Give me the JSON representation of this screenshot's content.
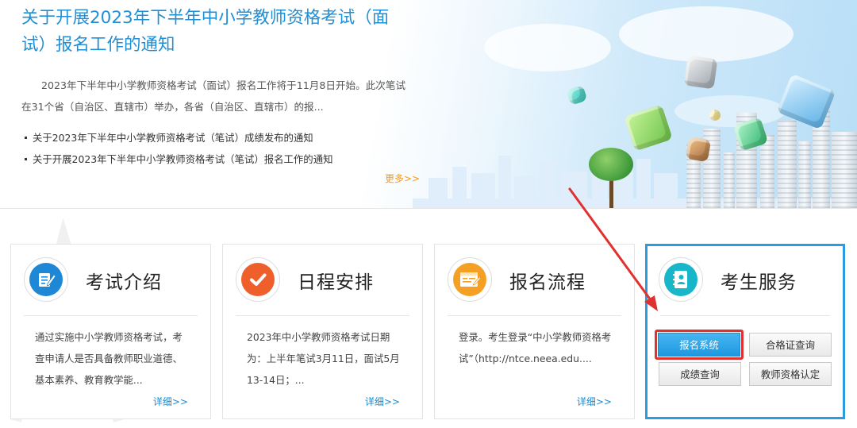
{
  "banner": {
    "headline": "关于开展2023年下半年中小学教师资格考试（面试）报名工作的通知",
    "summary": "2023年下半年中小学教师资格考试（面试）报名工作将于11月8日开始。此次笔试在31个省（自治区、直辖市）举办，各省（自治区、直辖市）的报...",
    "related": [
      "关于2023年下半年中小学教师资格考试（笔试）成绩发布的通知",
      "关于开展2023年下半年中小学教师资格考试（笔试）报名工作的通知"
    ],
    "more_label": "更多>>"
  },
  "cards": [
    {
      "title": "考试介绍",
      "icon": "document-pen-icon",
      "icon_color": "#1e88d6",
      "desc": "通过实施中小学教师资格考试，考查申请人是否具备教师职业道德、基本素养、教育教学能...",
      "detail_label": "详细>>"
    },
    {
      "title": "日程安排",
      "icon": "check-icon",
      "icon_color": "#ef5f2b",
      "desc": "2023年中小学教师资格考试日期为：上半年笔试3月11日，面试5月13-14日；...",
      "detail_label": "详细>>"
    },
    {
      "title": "报名流程",
      "icon": "form-icon",
      "icon_color": "#f4a024",
      "desc": "登录。考生登录“中小学教师资格考试”（http://ntce.neea.edu....",
      "detail_label": "详细>>"
    }
  ],
  "service": {
    "title": "考生服务",
    "icon": "contact-book-icon",
    "icon_color": "#18b6c9",
    "accent": "#2a9ce0",
    "buttons": {
      "register": "报名系统",
      "certificate_query": "合格证查询",
      "score_query": "成绩查询",
      "qualification": "教师资格认定"
    }
  },
  "annotation_color": "#e03131"
}
